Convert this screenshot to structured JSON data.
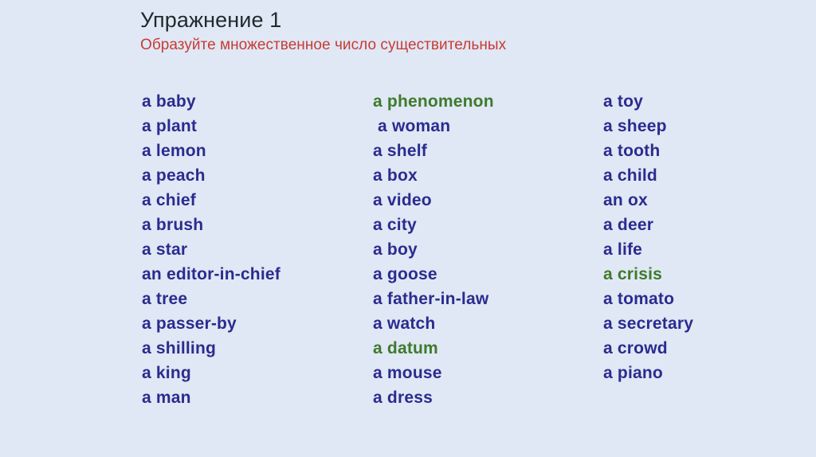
{
  "heading": {
    "title": "Упражнение 1",
    "instruction": "Образуйте множественное число существительных"
  },
  "colors": {
    "background": "#dfe8f4",
    "title_text": "#1f2a2e",
    "instruction_text": "#c93a36",
    "word_default": "#2b2b8f",
    "word_highlight": "#3f7a2c"
  },
  "columns": [
    {
      "id": "column-1",
      "items": [
        {
          "text": "a baby",
          "highlight": false
        },
        {
          "text": "a plant",
          "highlight": false
        },
        {
          "text": "a lemon",
          "highlight": false
        },
        {
          "text": "a peach",
          "highlight": false
        },
        {
          "text": "a chief",
          "highlight": false
        },
        {
          "text": "a brush",
          "highlight": false
        },
        {
          "text": "a star",
          "highlight": false
        },
        {
          "text": "an editor-in-chief",
          "highlight": false
        },
        {
          "text": "a tree",
          "highlight": false
        },
        {
          "text": "a passer-by",
          "highlight": false
        },
        {
          "text": "a shilling",
          "highlight": false
        },
        {
          "text": "a king",
          "highlight": false
        },
        {
          "text": "a man",
          "highlight": false
        }
      ]
    },
    {
      "id": "column-2",
      "items": [
        {
          "text": "a phenomenon",
          "highlight": true
        },
        {
          "text": " a woman",
          "highlight": false
        },
        {
          "text": "a shelf",
          "highlight": false
        },
        {
          "text": "a box",
          "highlight": false
        },
        {
          "text": "a video",
          "highlight": false
        },
        {
          "text": "a city",
          "highlight": false
        },
        {
          "text": "a boy",
          "highlight": false
        },
        {
          "text": "a goose",
          "highlight": false
        },
        {
          "text": "a father-in-law",
          "highlight": false
        },
        {
          "text": "a watch",
          "highlight": false
        },
        {
          "text": "a datum",
          "highlight": true
        },
        {
          "text": "a mouse",
          "highlight": false
        },
        {
          "text": "a dress",
          "highlight": false
        }
      ]
    },
    {
      "id": "column-3",
      "items": [
        {
          "text": "a toy",
          "highlight": false
        },
        {
          "text": "a sheep",
          "highlight": false
        },
        {
          "text": "a tooth",
          "highlight": false
        },
        {
          "text": "a child",
          "highlight": false
        },
        {
          "text": "an ox",
          "highlight": false
        },
        {
          "text": "a deer",
          "highlight": false
        },
        {
          "text": "a life",
          "highlight": false
        },
        {
          "text": "a crisis",
          "highlight": true
        },
        {
          "text": "a tomato",
          "highlight": false
        },
        {
          "text": "a secretary",
          "highlight": false
        },
        {
          "text": "a crowd",
          "highlight": false
        },
        {
          "text": "a piano",
          "highlight": false
        }
      ]
    }
  ]
}
